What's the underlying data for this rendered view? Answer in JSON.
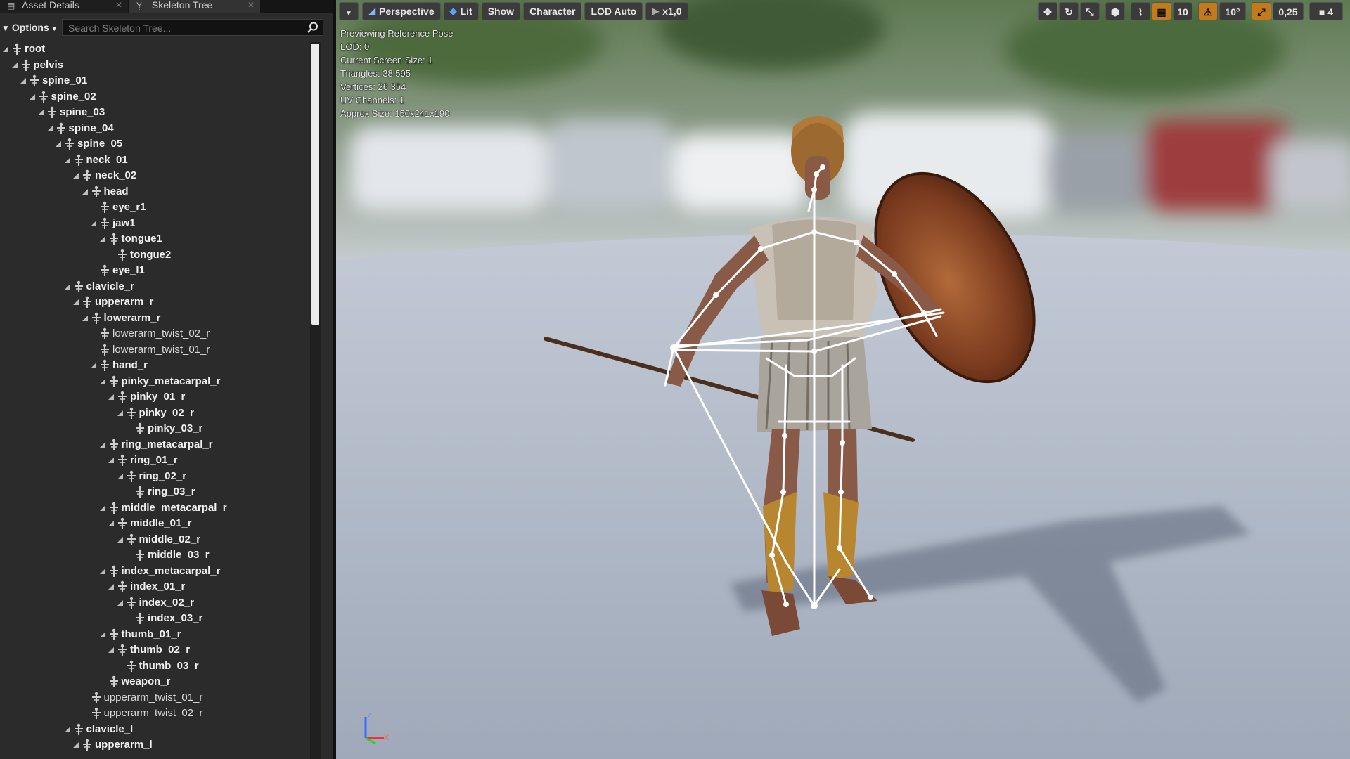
{
  "tabs": [
    {
      "label": "Asset Details",
      "icon": "details-icon"
    },
    {
      "label": "Skeleton Tree",
      "icon": "bone-icon"
    }
  ],
  "options_label": "Options",
  "search_placeholder": "Search Skeleton Tree...",
  "bones": [
    {
      "name": "root",
      "depth": 0,
      "expandable": true,
      "bold": true
    },
    {
      "name": "pelvis",
      "depth": 1,
      "expandable": true,
      "bold": true
    },
    {
      "name": "spine_01",
      "depth": 2,
      "expandable": true,
      "bold": true
    },
    {
      "name": "spine_02",
      "depth": 3,
      "expandable": true,
      "bold": true
    },
    {
      "name": "spine_03",
      "depth": 4,
      "expandable": true,
      "bold": true
    },
    {
      "name": "spine_04",
      "depth": 5,
      "expandable": true,
      "bold": true
    },
    {
      "name": "spine_05",
      "depth": 6,
      "expandable": true,
      "bold": true
    },
    {
      "name": "neck_01",
      "depth": 7,
      "expandable": true,
      "bold": true
    },
    {
      "name": "neck_02",
      "depth": 8,
      "expandable": true,
      "bold": true
    },
    {
      "name": "head",
      "depth": 9,
      "expandable": true,
      "bold": true
    },
    {
      "name": "eye_r1",
      "depth": 10,
      "expandable": false,
      "bold": true
    },
    {
      "name": "jaw1",
      "depth": 10,
      "expandable": true,
      "bold": true
    },
    {
      "name": "tongue1",
      "depth": 11,
      "expandable": true,
      "bold": true
    },
    {
      "name": "tongue2",
      "depth": 12,
      "expandable": false,
      "bold": true
    },
    {
      "name": "eye_l1",
      "depth": 10,
      "expandable": false,
      "bold": true
    },
    {
      "name": "clavicle_r",
      "depth": 7,
      "expandable": true,
      "bold": true
    },
    {
      "name": "upperarm_r",
      "depth": 8,
      "expandable": true,
      "bold": true
    },
    {
      "name": "lowerarm_r",
      "depth": 9,
      "expandable": true,
      "bold": true
    },
    {
      "name": "lowerarm_twist_02_r",
      "depth": 10,
      "expandable": false,
      "bold": false
    },
    {
      "name": "lowerarm_twist_01_r",
      "depth": 10,
      "expandable": false,
      "bold": false
    },
    {
      "name": "hand_r",
      "depth": 10,
      "expandable": true,
      "bold": true
    },
    {
      "name": "pinky_metacarpal_r",
      "depth": 11,
      "expandable": true,
      "bold": true
    },
    {
      "name": "pinky_01_r",
      "depth": 12,
      "expandable": true,
      "bold": true
    },
    {
      "name": "pinky_02_r",
      "depth": 13,
      "expandable": true,
      "bold": true
    },
    {
      "name": "pinky_03_r",
      "depth": 14,
      "expandable": false,
      "bold": true
    },
    {
      "name": "ring_metacarpal_r",
      "depth": 11,
      "expandable": true,
      "bold": true
    },
    {
      "name": "ring_01_r",
      "depth": 12,
      "expandable": true,
      "bold": true
    },
    {
      "name": "ring_02_r",
      "depth": 13,
      "expandable": true,
      "bold": true
    },
    {
      "name": "ring_03_r",
      "depth": 14,
      "expandable": false,
      "bold": true
    },
    {
      "name": "middle_metacarpal_r",
      "depth": 11,
      "expandable": true,
      "bold": true
    },
    {
      "name": "middle_01_r",
      "depth": 12,
      "expandable": true,
      "bold": true
    },
    {
      "name": "middle_02_r",
      "depth": 13,
      "expandable": true,
      "bold": true
    },
    {
      "name": "middle_03_r",
      "depth": 14,
      "expandable": false,
      "bold": true
    },
    {
      "name": "index_metacarpal_r",
      "depth": 11,
      "expandable": true,
      "bold": true
    },
    {
      "name": "index_01_r",
      "depth": 12,
      "expandable": true,
      "bold": true
    },
    {
      "name": "index_02_r",
      "depth": 13,
      "expandable": true,
      "bold": true
    },
    {
      "name": "index_03_r",
      "depth": 14,
      "expandable": false,
      "bold": true
    },
    {
      "name": "thumb_01_r",
      "depth": 11,
      "expandable": true,
      "bold": true
    },
    {
      "name": "thumb_02_r",
      "depth": 12,
      "expandable": true,
      "bold": true
    },
    {
      "name": "thumb_03_r",
      "depth": 13,
      "expandable": false,
      "bold": true
    },
    {
      "name": "weapon_r",
      "depth": 11,
      "expandable": false,
      "bold": true
    },
    {
      "name": "upperarm_twist_01_r",
      "depth": 9,
      "expandable": false,
      "bold": false
    },
    {
      "name": "upperarm_twist_02_r",
      "depth": 9,
      "expandable": false,
      "bold": false
    },
    {
      "name": "clavicle_l",
      "depth": 7,
      "expandable": true,
      "bold": true
    },
    {
      "name": "upperarm_l",
      "depth": 8,
      "expandable": true,
      "bold": true
    }
  ],
  "toolbar": {
    "perspective": "Perspective",
    "lit": "Lit",
    "show": "Show",
    "character": "Character",
    "lod": "LOD Auto",
    "speed": "x1,0",
    "grid_snap": "10",
    "rotation_snap": "10°",
    "scale_snap": "0,25",
    "camera_speed": "4"
  },
  "overlay": [
    "Previewing Reference Pose",
    "LOD: 0",
    "Current Screen Size: 1",
    "Triangles: 38 595",
    "Vertices: 26 354",
    "UV Channels: 1",
    "Approx Size: 150x241x190"
  ],
  "colors": {
    "panel_bg": "#2b2b2b",
    "accent_orange": "#c47a1a",
    "floor": "#a9b2c2"
  }
}
